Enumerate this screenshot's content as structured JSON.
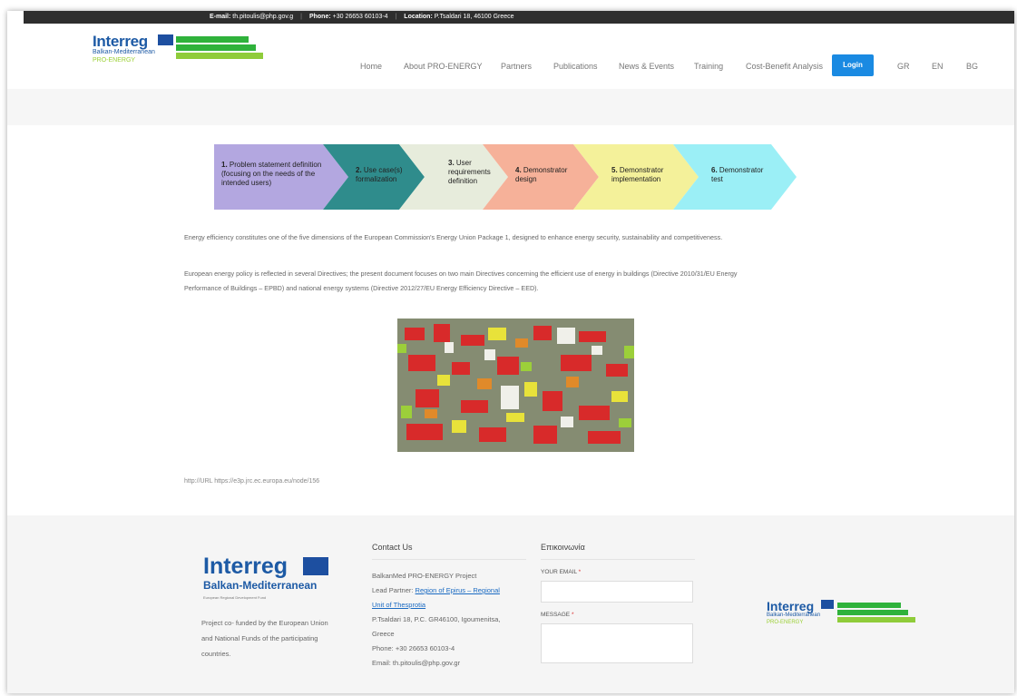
{
  "topbar": {
    "email_label": "E-mail:",
    "email": "th.pitoulis@php.gov.g",
    "phone_label": "Phone:",
    "phone": "+30 26653 60103-4",
    "location_label": "Location:",
    "location": "P.Tsaldari 18, 46100 Greece"
  },
  "logo": {
    "word": "Interreg",
    "program": "Balkan-Mediterranean",
    "project": "PRO-ENERGY"
  },
  "nav": {
    "items": [
      "Home",
      "About PRO-ENERGY",
      "Partners",
      "Publications",
      "News & Events",
      "Training",
      "Cost-Benefit Analysis"
    ],
    "login": "Login",
    "languages": [
      "GR",
      "EN",
      "BG"
    ]
  },
  "process": [
    {
      "num": "1.",
      "text": "Problem statement definition (focusing on the needs of the intended users)",
      "line1": "Problem statement definition",
      "line2": "(focusing on the needs of the",
      "line3": "intended users)",
      "color": "#b3a7e0"
    },
    {
      "num": "2.",
      "line1": "Use case(s)",
      "line2": "formalization",
      "line3": "",
      "color": "#2f8c8c"
    },
    {
      "num": "3.",
      "line1": "User",
      "line2": "requirements",
      "line3": "definition",
      "color": "#e7ecdc"
    },
    {
      "num": "4.",
      "line1": "Demonstrator",
      "line2": "design",
      "line3": "",
      "color": "#f6b199"
    },
    {
      "num": "5.",
      "line1": "Demonstrator",
      "line2": "implementation",
      "line3": "",
      "color": "#f4f19a"
    },
    {
      "num": "6.",
      "line1": "Demonstrator",
      "line2": "test",
      "line3": "",
      "color": "#9beff6"
    }
  ],
  "content": {
    "p1": "Energy efficiency constitutes one of the five dimensions of the European Commission's Energy Union Package 1, designed to enhance energy security, sustainability and competitiveness.",
    "p2a": "European energy policy is reflected in several Directives; the present document focuses on two main Directives concerning the efficient use of energy in buildings (Directive 2010/31/EU Energy",
    "p2b": "Performance of Buildings – EPBD) and national energy systems (Directive 2012/27/EU Energy Efficiency Directive – EED).",
    "url": "http://URL https://e3p.jrc.ec.europa.eu/node/156"
  },
  "footer": {
    "logo_word": "Interreg",
    "logo_program": "Balkan-Mediterranean",
    "logo_fund": "European Regional Development Fund",
    "funding_text": "Project co- funded by the European Union and National Funds of the participating countries.",
    "contact_title": "Contact Us",
    "contact_project": "BalkanMed PRO-ENERGY Project",
    "lead_partner_label": "Lead Partner:",
    "lead_partner_link1": "Region of Epirus – Regional",
    "lead_partner_link2": "Unit of Thesprotia",
    "address1": "P.Tsaldari 18, P.C. GR46100, Igoumenitsa,",
    "address2": "Greece",
    "phone": "Phone: +30 26653 60103-4",
    "email": "Email: th.pitoulis@php.gov.gr",
    "form_title": "Επικοινωνία",
    "email_field_label": "YOUR EMAIL",
    "message_field_label": "MESSAGE",
    "required_mark": "*"
  },
  "colors": {
    "accent": "#1a8ae2",
    "brand_blue": "#1d5aa5",
    "brand_green": "#2fb23b"
  }
}
